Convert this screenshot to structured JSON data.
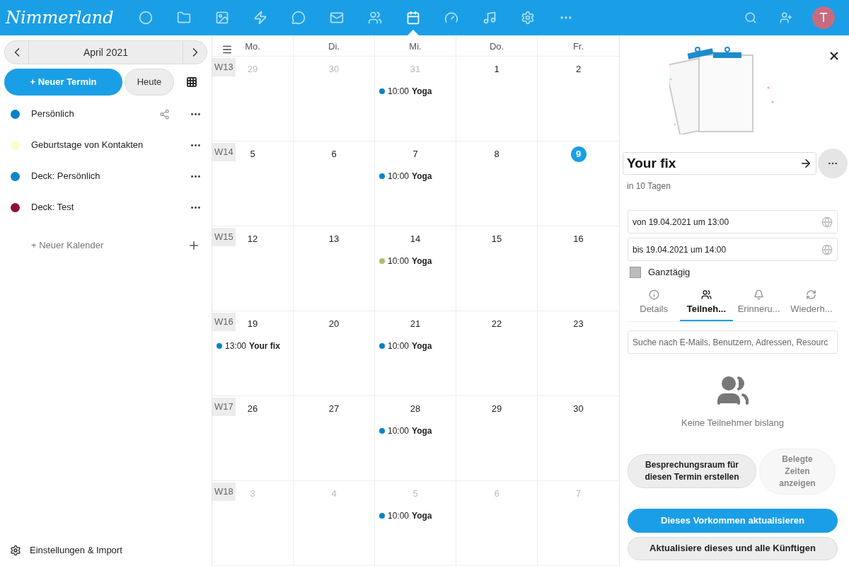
{
  "header": {
    "logo": "Nimmerland",
    "apps": [
      {
        "kind": "dashboard",
        "selected": false
      },
      {
        "kind": "files",
        "selected": false
      },
      {
        "kind": "photos",
        "selected": false
      },
      {
        "kind": "activity",
        "selected": false
      },
      {
        "kind": "talk",
        "selected": false
      },
      {
        "kind": "mail",
        "selected": false
      },
      {
        "kind": "contacts",
        "selected": false
      },
      {
        "kind": "calendar",
        "selected": true
      },
      {
        "kind": "clock",
        "selected": false
      },
      {
        "kind": "music",
        "selected": false
      },
      {
        "kind": "settings",
        "selected": false
      },
      {
        "kind": "more",
        "selected": false
      }
    ],
    "avatar": "T"
  },
  "sidebar": {
    "month": "April 2021",
    "new_event": "+ Neuer Termin",
    "today": "Heute",
    "calendars": [
      {
        "name": "Persönlich",
        "color": "#0082c9",
        "shared": true
      },
      {
        "name": "Geburtstage von Kontakten",
        "color": "#fdfbc6",
        "shared": false
      },
      {
        "name": "Deck: Persönlich",
        "color": "#0c86c6",
        "shared": false
      },
      {
        "name": "Deck: Test",
        "color": "#8e0f3e",
        "shared": false
      }
    ],
    "new_calendar": "+ Neuer Kalender",
    "settings": "Einstellungen & Import"
  },
  "calendar": {
    "weekdays": [
      "Mo.",
      "Di.",
      "Mi.",
      "Do.",
      "Fr."
    ],
    "weeks": [
      {
        "label": "W13",
        "days": [
          {
            "day": "29",
            "muted": true,
            "today": false
          },
          {
            "day": "30",
            "muted": true,
            "today": false
          },
          {
            "day": "31",
            "muted": true,
            "today": false,
            "events": [
              {
                "time": "10:00",
                "title": "Yoga",
                "color": "#0082c9"
              }
            ]
          },
          {
            "day": "1",
            "muted": false,
            "today": false
          },
          {
            "day": "2",
            "muted": false,
            "today": false
          }
        ]
      },
      {
        "label": "W14",
        "days": [
          {
            "day": "5",
            "muted": false,
            "today": false
          },
          {
            "day": "6",
            "muted": false,
            "today": false
          },
          {
            "day": "7",
            "muted": false,
            "today": false,
            "events": [
              {
                "time": "10:00",
                "title": "Yoga",
                "color": "#0082c9"
              }
            ]
          },
          {
            "day": "8",
            "muted": false,
            "today": false
          },
          {
            "day": "9",
            "muted": false,
            "today": true
          }
        ]
      },
      {
        "label": "W15",
        "days": [
          {
            "day": "12",
            "muted": false,
            "today": false
          },
          {
            "day": "13",
            "muted": false,
            "today": false
          },
          {
            "day": "14",
            "muted": false,
            "today": false,
            "events": [
              {
                "time": "10:00",
                "title": "Yoga",
                "color": "#b6b86c"
              }
            ]
          },
          {
            "day": "15",
            "muted": false,
            "today": false
          },
          {
            "day": "16",
            "muted": false,
            "today": false
          }
        ]
      },
      {
        "label": "W16",
        "days": [
          {
            "day": "19",
            "muted": false,
            "today": false,
            "events": [
              {
                "time": "13:00",
                "title": "Your fix",
                "color": "#0082c9"
              }
            ]
          },
          {
            "day": "20",
            "muted": false,
            "today": false
          },
          {
            "day": "21",
            "muted": false,
            "today": false,
            "events": [
              {
                "time": "10:00",
                "title": "Yoga",
                "color": "#0082c9"
              }
            ]
          },
          {
            "day": "22",
            "muted": false,
            "today": false
          },
          {
            "day": "23",
            "muted": false,
            "today": false
          }
        ]
      },
      {
        "label": "W17",
        "days": [
          {
            "day": "26",
            "muted": false,
            "today": false
          },
          {
            "day": "27",
            "muted": false,
            "today": false
          },
          {
            "day": "28",
            "muted": false,
            "today": false,
            "events": [
              {
                "time": "10:00",
                "title": "Yoga",
                "color": "#0082c9"
              }
            ]
          },
          {
            "day": "29",
            "muted": false,
            "today": false
          },
          {
            "day": "30",
            "muted": false,
            "today": false
          }
        ]
      },
      {
        "label": "W18",
        "days": [
          {
            "day": "3",
            "muted": true,
            "today": false
          },
          {
            "day": "4",
            "muted": true,
            "today": false
          },
          {
            "day": "5",
            "muted": true,
            "today": false,
            "events": [
              {
                "time": "10:00",
                "title": "Yoga",
                "color": "#0082c9"
              }
            ]
          },
          {
            "day": "6",
            "muted": true,
            "today": false
          },
          {
            "day": "7",
            "muted": true,
            "today": false
          }
        ]
      }
    ]
  },
  "panel": {
    "title": "Your fix",
    "subtitle": "in 10 Tagen",
    "from": "von 19.04.2021 um 13:00",
    "to": "bis 19.04.2021 um 14:00",
    "all_day": {
      "label": "Ganztägig",
      "checked": false
    },
    "tabs": [
      {
        "kind": "details",
        "label": "Details",
        "selected": false
      },
      {
        "kind": "attendees",
        "label": "Teilneh...",
        "selected": true
      },
      {
        "kind": "reminders",
        "label": "Erinneru...",
        "selected": false
      },
      {
        "kind": "repeat",
        "label": "Wiederh...",
        "selected": false
      }
    ],
    "search": {
      "placeholder": "Suche nach E-Mails, Benutzern, Adressen, Resourc"
    },
    "empty": "Keine Teilnehmer bislang",
    "room_buttons": [
      {
        "label": "Besprechungsraum für diesen Termin erstellen",
        "disabled": false
      },
      {
        "label": "Belegte Zeiten anzeigen",
        "disabled": true
      }
    ],
    "primary": "Dieses Vorkommen aktualisieren",
    "secondary": "Aktualisiere dieses und alle Künftigen"
  }
}
